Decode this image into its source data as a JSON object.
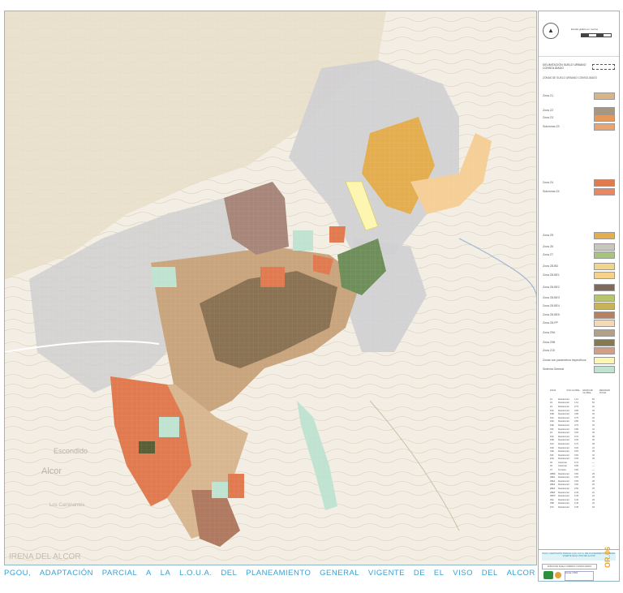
{
  "footer": {
    "words": [
      "PGOU,",
      "ADAPTACIÓN",
      "PARCIAL",
      "A",
      "LA",
      "L.O.U.A.",
      "DEL",
      "PLANEAMIENTO",
      "GENERAL",
      "VIGENTE",
      "DE",
      "EL",
      "VISO",
      "DEL",
      "ALCOR"
    ]
  },
  "map": {
    "place_labels": [
      {
        "text": "Escondido"
      },
      {
        "text": "Alcor"
      },
      {
        "text": "IRENA  DEL  ALCOR"
      },
      {
        "text": "Los Caminantes"
      }
    ]
  },
  "legend": {
    "scale_label": "Escala gráfica en metros",
    "scale_ticks": [
      "0",
      "50",
      "100",
      "200"
    ],
    "title": "DELIMITACIÓN SUELO URBANO CONSOLIDADO",
    "subtitle": "ZONAS DE SUELO URBANO CONSOLIDADO",
    "rows": [
      {
        "label": "Zona Z1",
        "color": "#d9b48a"
      },
      {
        "label": "Zona Z2",
        "color": "#a9977d"
      },
      {
        "label": "Zona Z3",
        "color": "#e39a5a"
      },
      {
        "label": "Subzonas Z3",
        "color": "#e8a472"
      },
      {
        "label": "Zona Z4",
        "color": "#e27a4f"
      },
      {
        "label": "Subzonas Z4",
        "color": "#ea8763"
      },
      {
        "label": "Zona Z5",
        "color": "#e4ae4e"
      },
      {
        "label": "Zona Z6",
        "color": "#c7c7bb"
      },
      {
        "label": "Zona Z7",
        "color": "#a7c47c"
      },
      {
        "label": "Zona Z8-BD",
        "color": "#f1d68a"
      },
      {
        "label": "Zona Z8-BE1",
        "color": "#f7d08a"
      },
      {
        "label": "Zona Z8-BE2",
        "color": "#7e6a5a"
      },
      {
        "label": "Zona Z8-BE3",
        "color": "#b9c46e"
      },
      {
        "label": "Zona Z8-BE4",
        "color": "#c9b35a"
      },
      {
        "label": "Zona Z8-BE5",
        "color": "#b88060"
      },
      {
        "label": "Zona Z8-PP",
        "color": "#f5d9b0"
      },
      {
        "label": "Zona Z9A",
        "color": "#b2a186"
      },
      {
        "label": "Zona Z9B",
        "color": "#847a4e"
      },
      {
        "label": "Zona Z10",
        "color": "#d49d84"
      },
      {
        "label": "Zonas con parámetros específicos",
        "color": "#fdf6b0"
      },
      {
        "label": "Sistema General",
        "color": "#bfe3d0"
      }
    ],
    "table_header": [
      "ZONA",
      "USO GLOBAL",
      "EDIFICAB. GLOBAL",
      "DENSIDAD VIV/HA"
    ],
    "table_rows": [
      [
        "Z1",
        "Residencial",
        "1,10",
        "50"
      ],
      [
        "Z2",
        "Residencial",
        "1,10",
        "50"
      ],
      [
        "Z3",
        "Residencial",
        "0,75",
        "40"
      ],
      [
        "Z3A",
        "Residencial",
        "0,85",
        "45"
      ],
      [
        "Z3B",
        "Residencial",
        "0,85",
        "45"
      ],
      [
        "Z3C",
        "Residencial",
        "0,75",
        "40"
      ],
      [
        "Z3D",
        "Residencial",
        "0,80",
        "42"
      ],
      [
        "Z3E",
        "Residencial",
        "0,75",
        "40"
      ],
      [
        "Z3F",
        "Residencial",
        "0,80",
        "42"
      ],
      [
        "Z4",
        "Residencial",
        "0,65",
        "35"
      ],
      [
        "Z4A",
        "Residencial",
        "0,70",
        "38"
      ],
      [
        "Z4B",
        "Residencial",
        "0,65",
        "35"
      ],
      [
        "Z4C",
        "Residencial",
        "0,70",
        "38"
      ],
      [
        "Z4D",
        "Residencial",
        "0,60",
        "32"
      ],
      [
        "Z4E",
        "Residencial",
        "0,65",
        "35"
      ],
      [
        "Z4F",
        "Residencial",
        "0,60",
        "32"
      ],
      [
        "Z4G",
        "Residencial",
        "0,65",
        "35"
      ],
      [
        "Z5",
        "Industrial",
        "0,70",
        "—"
      ],
      [
        "Z6",
        "Industrial",
        "0,80",
        "—"
      ],
      [
        "Z7",
        "Terciario",
        "0,60",
        "—"
      ],
      [
        "Z8BD",
        "Residencial",
        "0,50",
        "25"
      ],
      [
        "Z8E1",
        "Residencial",
        "0,55",
        "28"
      ],
      [
        "Z8E2",
        "Residencial",
        "0,55",
        "28"
      ],
      [
        "Z8E3",
        "Residencial",
        "0,50",
        "25"
      ],
      [
        "Z8E4",
        "Residencial",
        "0,50",
        "25"
      ],
      [
        "Z8E5",
        "Residencial",
        "0,45",
        "22"
      ],
      [
        "Z8PP",
        "Residencial",
        "0,45",
        "22"
      ],
      [
        "Z9A",
        "Residencial",
        "0,40",
        "20"
      ],
      [
        "Z9B",
        "Residencial",
        "0,40",
        "20"
      ],
      [
        "Z10",
        "Residencial",
        "0,35",
        "18"
      ]
    ]
  },
  "title_block": {
    "description": "PGOU, ADAPTACIÓN PARCIAL A LA L.O.U.A. DEL PLANEAMIENTO GENERAL VIGENTE DE EL VISO DEL ALCOR",
    "sheet_title": "ZONAS DE SUELO URBANO CONSOLIDADO",
    "code": "OR.06",
    "small_text": "Escala 1:5000"
  },
  "colors": {
    "border": "#8fb8c8",
    "footer_text": "#3aa0d0",
    "code": "#e2a43a"
  }
}
